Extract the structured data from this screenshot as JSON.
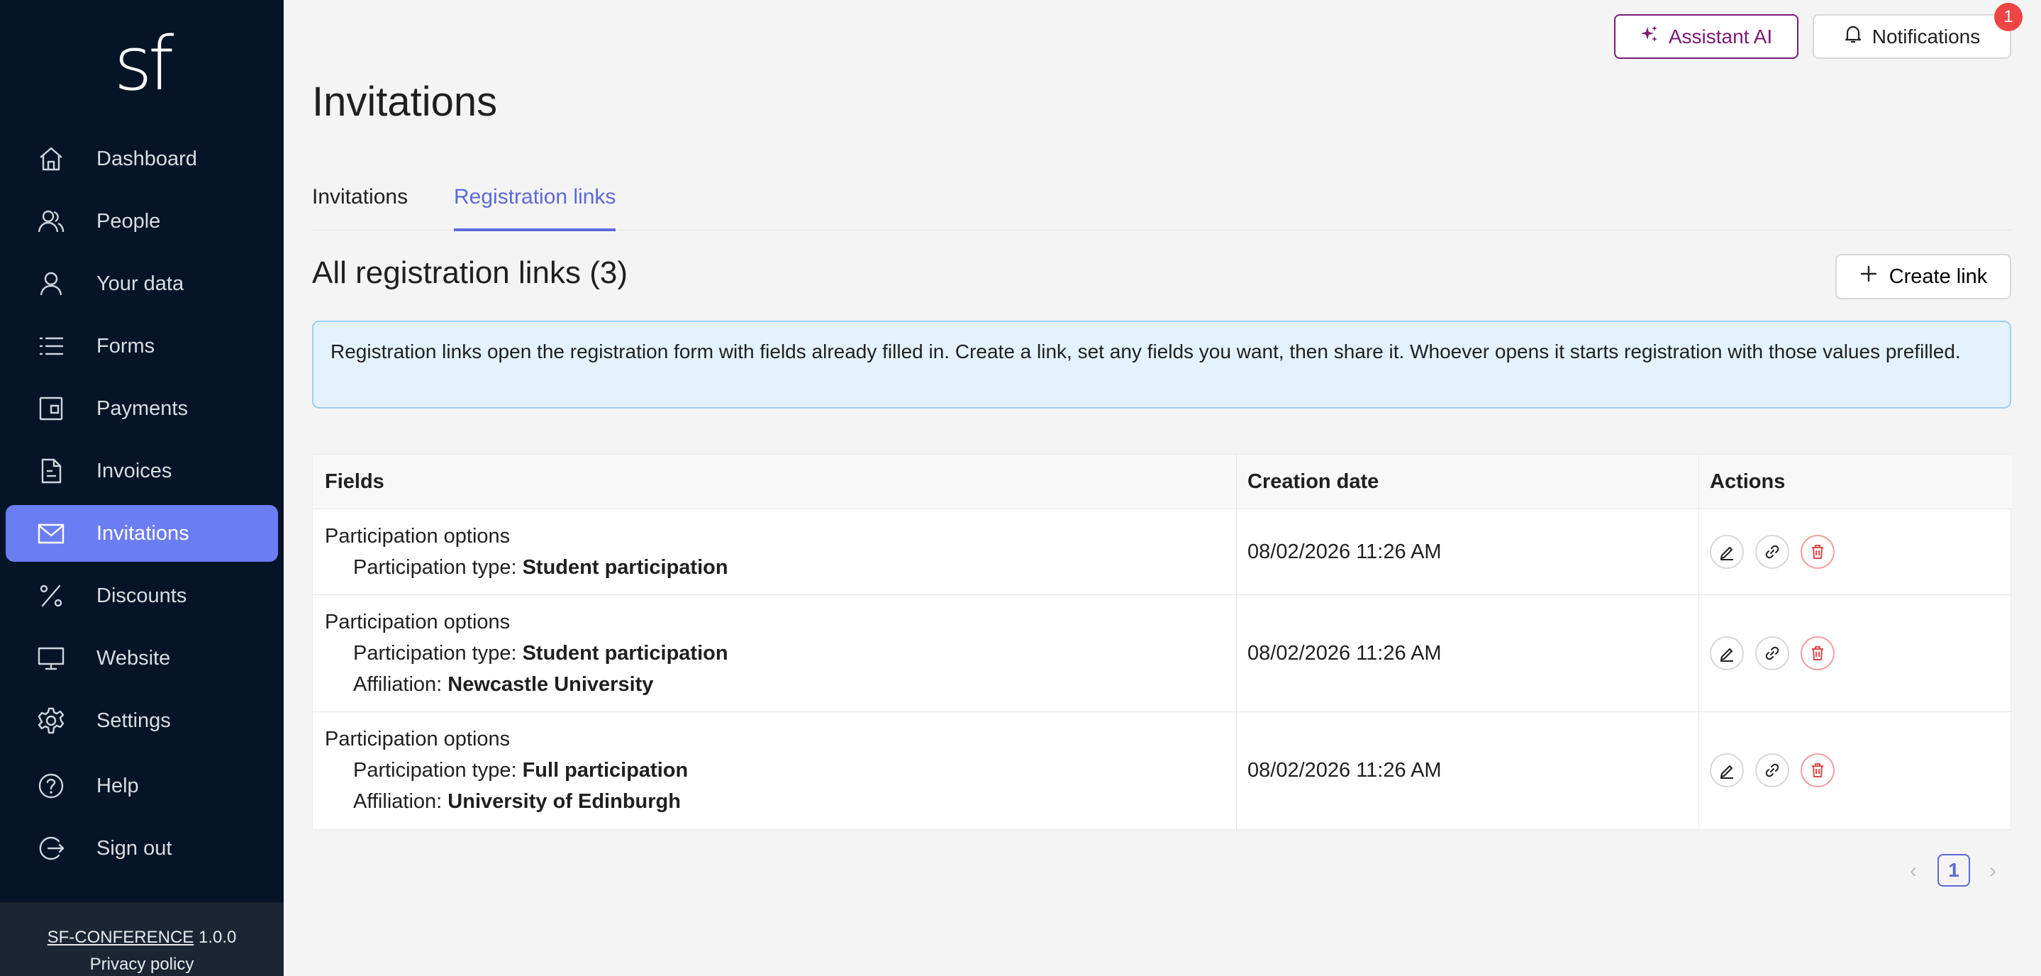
{
  "app": {
    "logo": "sf"
  },
  "sidebar": {
    "items": [
      {
        "label": "Dashboard",
        "icon": "home-icon"
      },
      {
        "label": "People",
        "icon": "people-icon"
      },
      {
        "label": "Your data",
        "icon": "user-icon"
      },
      {
        "label": "Forms",
        "icon": "list-icon"
      },
      {
        "label": "Payments",
        "icon": "wallet-icon"
      },
      {
        "label": "Invoices",
        "icon": "document-icon"
      },
      {
        "label": "Invitations",
        "icon": "mail-icon",
        "active": true
      },
      {
        "label": "Discounts",
        "icon": "percent-icon"
      },
      {
        "label": "Website",
        "icon": "monitor-icon"
      },
      {
        "label": "Settings",
        "icon": "gear-icon"
      },
      {
        "label": "Help",
        "icon": "help-icon"
      },
      {
        "label": "Sign out",
        "icon": "sign-out-icon"
      }
    ],
    "footer": {
      "product": "SF-CONFERENCE",
      "version": "1.0.0",
      "privacy": "Privacy policy"
    }
  },
  "topbar": {
    "assistant_label": "Assistant AI",
    "notifications_label": "Notifications",
    "notifications_count": "1"
  },
  "page": {
    "title": "Invitations",
    "tabs": [
      {
        "label": "Invitations"
      },
      {
        "label": "Registration links",
        "active": true
      }
    ],
    "section_title": "All registration links (3)",
    "create_label": "Create link",
    "info_text": "Registration links open the registration form with fields already filled in. Create a link, set any fields you want, then share it. Whoever opens it starts registration with those values prefilled."
  },
  "table": {
    "columns": [
      "Fields",
      "Creation date",
      "Actions"
    ],
    "rows": [
      {
        "group": "Participation options",
        "fields": [
          {
            "name": "Participation type:",
            "value": "Student participation"
          }
        ],
        "date": "08/02/2026 11:26 AM"
      },
      {
        "group": "Participation options",
        "fields": [
          {
            "name": "Participation type:",
            "value": "Student participation"
          },
          {
            "name": "Affiliation:",
            "value": "Newcastle University"
          }
        ],
        "date": "08/02/2026 11:26 AM"
      },
      {
        "group": "Participation options",
        "fields": [
          {
            "name": "Participation type:",
            "value": "Full participation"
          },
          {
            "name": "Affiliation:",
            "value": "University of Edinburgh"
          }
        ],
        "date": "08/02/2026 11:26 AM"
      }
    ]
  },
  "pagination": {
    "current": "1",
    "prev": "‹",
    "next": "›"
  },
  "colors": {
    "sidebar_bg": "#051426",
    "accent": "#6b7df3",
    "tab_active": "#5b6ad8",
    "ai_purple": "#7a1a73",
    "danger": "#ef4444"
  }
}
